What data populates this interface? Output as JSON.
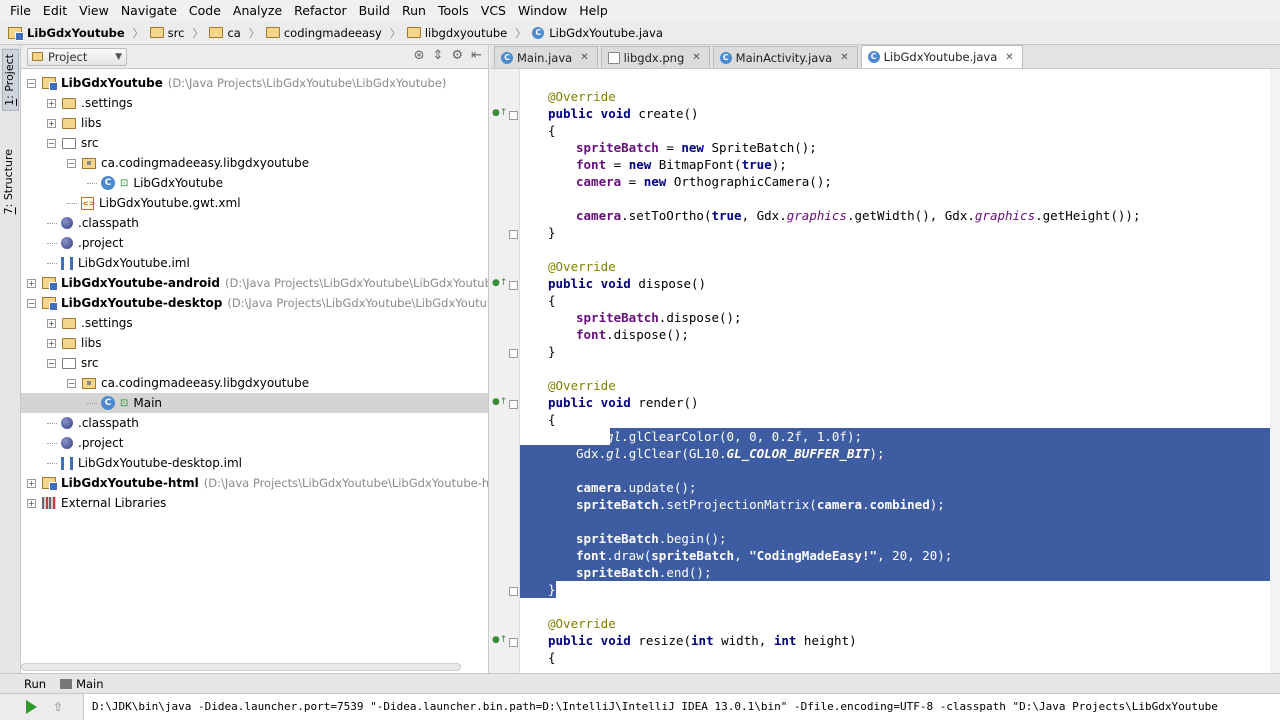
{
  "menu": [
    "File",
    "Edit",
    "View",
    "Navigate",
    "Code",
    "Analyze",
    "Refactor",
    "Build",
    "Run",
    "Tools",
    "VCS",
    "Window",
    "Help"
  ],
  "breadcrumbs": [
    "LibGdxYoutube",
    "src",
    "ca",
    "codingmadeeasy",
    "libgdxyoutube",
    "LibGdxYoutube.java"
  ],
  "left_strip": {
    "project_num": "1",
    "project_label": ": Project",
    "structure_num": "7",
    "structure_label": ": Structure"
  },
  "project_panel": {
    "dropdown_label": "Project",
    "tree": [
      {
        "depth": 0,
        "toggle": "−",
        "icon": "module",
        "label": "LibGdxYoutube",
        "bold": true,
        "path": "(D:\\Java Projects\\LibGdxYoutube\\LibGdxYoutube)"
      },
      {
        "depth": 1,
        "toggle": "+",
        "icon": "folder",
        "label": ".settings"
      },
      {
        "depth": 1,
        "toggle": "+",
        "icon": "folder",
        "label": "libs"
      },
      {
        "depth": 1,
        "toggle": "−",
        "icon": "folder-open",
        "label": "src"
      },
      {
        "depth": 2,
        "toggle": "−",
        "icon": "package",
        "label": "ca.codingmadeeasy.libgdxyoutube"
      },
      {
        "depth": 3,
        "toggle": "",
        "icon": "class",
        "label": "LibGdxYoutube"
      },
      {
        "depth": 2,
        "toggle": "",
        "icon": "xml",
        "label": "LibGdxYoutube.gwt.xml"
      },
      {
        "depth": 1,
        "toggle": "",
        "icon": "sphere",
        "label": ".classpath"
      },
      {
        "depth": 1,
        "toggle": "",
        "icon": "sphere",
        "label": ".project"
      },
      {
        "depth": 1,
        "toggle": "",
        "icon": "iml",
        "label": "LibGdxYoutube.iml"
      },
      {
        "depth": 0,
        "toggle": "+",
        "icon": "module",
        "label": "LibGdxYoutube-android",
        "bold": true,
        "path": "(D:\\Java Projects\\LibGdxYoutube\\LibGdxYoutube-android)"
      },
      {
        "depth": 0,
        "toggle": "−",
        "icon": "module",
        "label": "LibGdxYoutube-desktop",
        "bold": true,
        "path": "(D:\\Java Projects\\LibGdxYoutube\\LibGdxYoutube-desktop)"
      },
      {
        "depth": 1,
        "toggle": "+",
        "icon": "folder",
        "label": ".settings"
      },
      {
        "depth": 1,
        "toggle": "+",
        "icon": "folder",
        "label": "libs"
      },
      {
        "depth": 1,
        "toggle": "−",
        "icon": "folder-open",
        "label": "src"
      },
      {
        "depth": 2,
        "toggle": "−",
        "icon": "package",
        "label": "ca.codingmadeeasy.libgdxyoutube"
      },
      {
        "depth": 3,
        "toggle": "",
        "icon": "class-run",
        "label": "Main",
        "selected": true
      },
      {
        "depth": 1,
        "toggle": "",
        "icon": "sphere",
        "label": ".classpath"
      },
      {
        "depth": 1,
        "toggle": "",
        "icon": "sphere",
        "label": ".project"
      },
      {
        "depth": 1,
        "toggle": "",
        "icon": "iml",
        "label": "LibGdxYoutube-desktop.iml"
      },
      {
        "depth": 0,
        "toggle": "+",
        "icon": "module",
        "label": "LibGdxYoutube-html",
        "bold": true,
        "path": "(D:\\Java Projects\\LibGdxYoutube\\LibGdxYoutube-html)"
      },
      {
        "depth": 0,
        "toggle": "+",
        "icon": "lib",
        "label": "External Libraries"
      }
    ]
  },
  "editor_tabs": [
    {
      "label": "Main.java",
      "icon": "C",
      "active": false
    },
    {
      "label": "libgdx.png",
      "icon": "img",
      "active": false
    },
    {
      "label": "MainActivity.java",
      "icon": "C",
      "active": false
    },
    {
      "label": "LibGdxYoutube.java",
      "icon": "C",
      "active": true
    }
  ],
  "code_lines": [
    {
      "line": 1,
      "indent": 1,
      "html": "<span style='color:#808000'>@Override</span>"
    },
    {
      "line": 2,
      "indent": 1,
      "html": "<b style='color:#000080'>public void</b> create()"
    },
    {
      "line": 3,
      "indent": 1,
      "html": "{"
    },
    {
      "line": 4,
      "indent": 2,
      "html": "<b style='color:#660e7a'>spriteBatch</b> = <b style='color:#000080'>new</b> SpriteBatch();"
    },
    {
      "line": 5,
      "indent": 2,
      "html": "<b style='color:#660e7a'>font</b> = <b style='color:#000080'>new</b> BitmapFont(<b style='color:#000080'>true</b>);"
    },
    {
      "line": 6,
      "indent": 2,
      "html": "<b style='color:#660e7a'>camera</b> = <b style='color:#000080'>new</b> OrthographicCamera();"
    },
    {
      "line": 8,
      "indent": 2,
      "html": "<b style='color:#660e7a'>camera</b>.setToOrtho(<b style='color:#000080'>true</b>, Gdx.<i style='color:#660e7a'>graphics</i>.getWidth(), Gdx.<i style='color:#660e7a'>graphics</i>.getHeight());"
    },
    {
      "line": 9,
      "indent": 1,
      "html": "}"
    },
    {
      "line": 11,
      "indent": 1,
      "html": "<span style='color:#808000'>@Override</span>"
    },
    {
      "line": 12,
      "indent": 1,
      "html": "<b style='color:#000080'>public void</b> dispose()"
    },
    {
      "line": 13,
      "indent": 1,
      "html": "{"
    },
    {
      "line": 14,
      "indent": 2,
      "html": "<b style='color:#660e7a'>spriteBatch</b>.dispose();"
    },
    {
      "line": 15,
      "indent": 2,
      "html": "<b style='color:#660e7a'>font</b>.dispose();"
    },
    {
      "line": 16,
      "indent": 1,
      "html": "}"
    },
    {
      "line": 18,
      "indent": 1,
      "html": "<span style='color:#808000'>@Override</span>"
    },
    {
      "line": 19,
      "indent": 1,
      "html": "<b style='color:#000080'>public void</b> render()"
    },
    {
      "line": 20,
      "indent": 1,
      "html": "{"
    },
    {
      "line": 21,
      "indent": 2,
      "sel": true,
      "html": "Gdx.<i>gl</i>.glClearColor(0, 0, 0.2f, 1.0f);"
    },
    {
      "line": 22,
      "indent": 2,
      "sel": true,
      "html": "Gdx.<i>gl</i>.glClear(GL10.<b><i>GL_COLOR_BUFFER_BIT</i></b>);"
    },
    {
      "line": 24,
      "indent": 2,
      "sel": true,
      "html": "<b>camera</b>.update();"
    },
    {
      "line": 25,
      "indent": 2,
      "sel": true,
      "html": "<b>spriteBatch</b>.setProjectionMatrix(<b>camera</b>.<b>combined</b>);"
    },
    {
      "line": 27,
      "indent": 2,
      "sel": true,
      "html": "<b>spriteBatch</b>.begin();"
    },
    {
      "line": 28,
      "indent": 2,
      "sel": true,
      "html": "<b>font</b>.draw(<b>spriteBatch</b>, <b>\"CodingMadeEasy!\"</b>, 20, 20);"
    },
    {
      "line": 29,
      "indent": 2,
      "sel": true,
      "html": "<b>spriteBatch</b>.end();"
    },
    {
      "line": 30,
      "indent": 1,
      "sel": true,
      "html": "}"
    },
    {
      "line": 32,
      "indent": 1,
      "html": "<span style='color:#808000'>@Override</span>"
    },
    {
      "line": 33,
      "indent": 1,
      "html": "<b style='color:#000080'>public void</b> resize(<b style='color:#000080'>int</b> width, <b style='color:#000080'>int</b> height)"
    },
    {
      "line": 34,
      "indent": 1,
      "html": "{"
    }
  ],
  "run_panel": {
    "tab_label": "Run",
    "config_label": "Main",
    "command": "D:\\JDK\\bin\\java -Didea.launcher.port=7539 \"-Didea.launcher.bin.path=D:\\IntelliJ\\IntelliJ IDEA 13.0.1\\bin\" -Dfile.encoding=UTF-8 -classpath \"D:\\Java Projects\\LibGdxYoutube"
  },
  "colors": {
    "selection": "#3d5ca1",
    "keyword": "#000080",
    "field": "#660e7a",
    "annotation": "#808000"
  }
}
